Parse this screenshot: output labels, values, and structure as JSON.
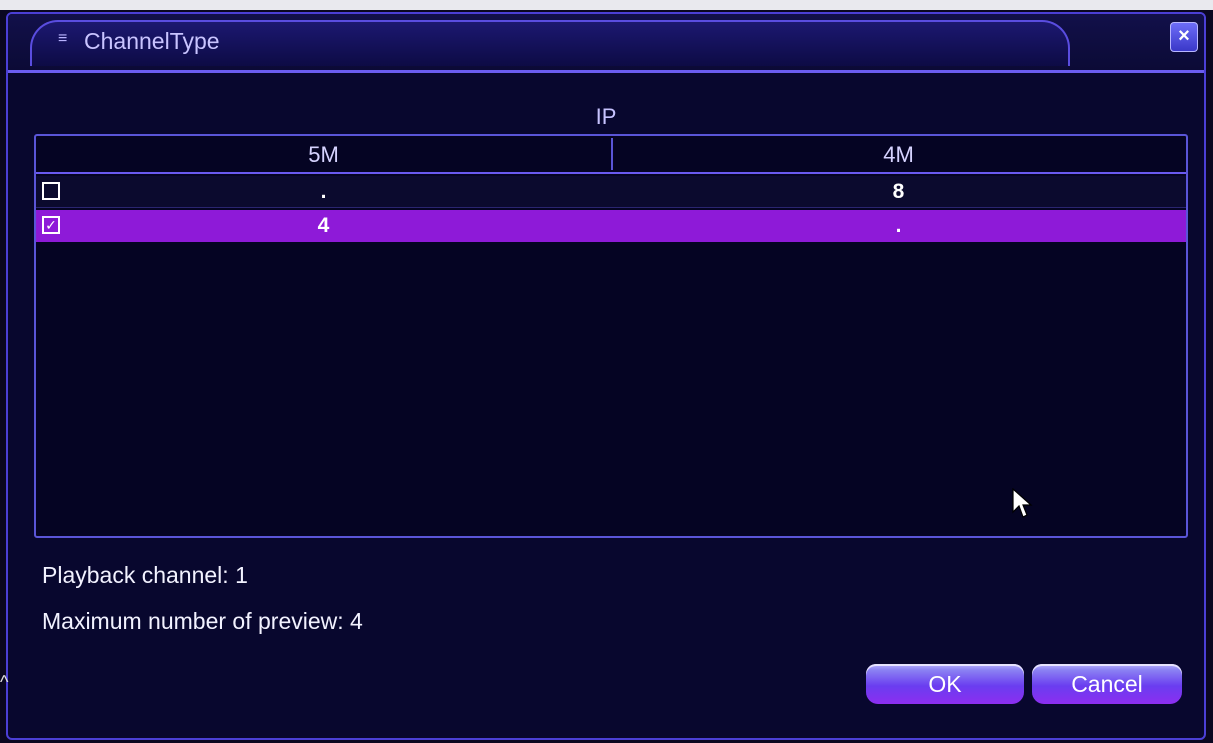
{
  "window": {
    "title": "ChannelType",
    "close_symbol": "×"
  },
  "section": {
    "label": "IP"
  },
  "table": {
    "headers": [
      "5M",
      "4M"
    ],
    "rows": [
      {
        "checked": false,
        "check_symbol": "",
        "cells": [
          ".",
          "8"
        ],
        "selected": false
      },
      {
        "checked": true,
        "check_symbol": "✓",
        "cells": [
          "4",
          "."
        ],
        "selected": true
      }
    ]
  },
  "info": {
    "playback": "Playback channel: 1",
    "preview": "Maximum number of preview: 4"
  },
  "buttons": {
    "ok": "OK",
    "cancel": "Cancel"
  },
  "colors": {
    "accent_selected_row": "#8e1ad8",
    "border": "#5a55d8",
    "background": "#08072e"
  }
}
